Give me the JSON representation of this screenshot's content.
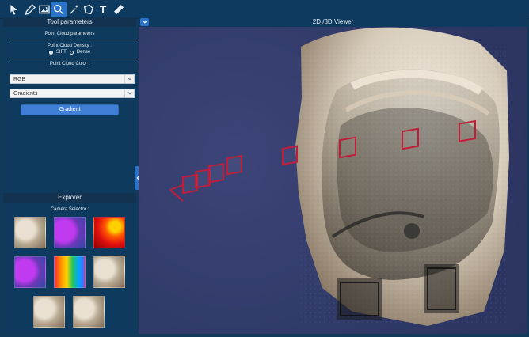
{
  "toolbar": {
    "tools": [
      {
        "name": "select"
      },
      {
        "name": "pen"
      },
      {
        "name": "image"
      },
      {
        "name": "zoom"
      },
      {
        "name": "magic-wand"
      },
      {
        "name": "lasso"
      },
      {
        "name": "text",
        "label": "T"
      },
      {
        "name": "ruler"
      }
    ]
  },
  "left_panel": {
    "tool_parameters": {
      "header": "Tool parameters",
      "point_cloud_parameters": "Point Cloud parameters",
      "density_label": "Point Cloud Density :",
      "density_options": [
        "SIFT",
        "Dense"
      ],
      "color_label": "Point Cloud Color :",
      "color_select_value": "RGB",
      "mode_select_value": "Gradients",
      "gradient_button": "Gradient"
    },
    "explorer": {
      "header": "Explorer",
      "camera_selector": "Camera Selector :"
    }
  },
  "viewer": {
    "title": "2D /3D Viewer"
  }
}
